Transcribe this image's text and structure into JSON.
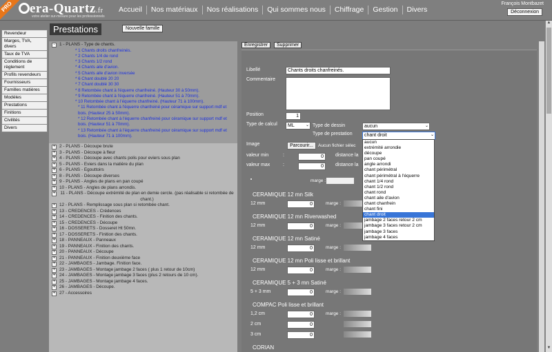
{
  "header": {
    "badge": "PRO",
    "logo_pre": "era-Quartz",
    "logo_suf": ".fr",
    "tagline": "votre atelier sur-mesure pour les professionnels",
    "nav": [
      "Accueil",
      "Nos matériaux",
      "Nos réalisations",
      "Qui sommes nous",
      "Chiffrage",
      "Gestion",
      "Divers"
    ],
    "user": "François Montbazet",
    "logout": "Déconnexion"
  },
  "sidebar": [
    "Revendeur",
    "Marges, TVA, divers",
    "Taux de TVA",
    "Conditions de règlement",
    "Profils revendeurs",
    "Fournisseurs",
    "Familles matières",
    "Modèles",
    "Prestations",
    "Finitions",
    "Civilités",
    "Divers"
  ],
  "page": {
    "title": "Prestations",
    "new_family": "Nouvelle famille"
  },
  "tree": {
    "selected": "1 - PLANS - Type de chants.",
    "selected_toggle": "-",
    "children": [
      "* 1 Chants droits chanfreinés.",
      "* 2 Chants 1/4 de rond",
      "* 3 Chants 1/2 rond",
      "* 4 Chants aile d'avion.",
      "* 5 Chants aile d'avion inversée",
      "* 6 Chant doublé 20 20",
      "* 7 Chant doublé 30 30",
      "* 8 Retombée chant à l'équerre chanfreiné. (Hauteur 30 à 50mm).",
      "* 9 Retombée chant à l'équerre chanfreiné. (Hauteur 51 à 70mm).",
      "* 10 Retombée chant à l'équerre chanfreiné. (Hauteur 71 à 100mm).",
      "* 11 Retombée chant à l'équerre chanfreiné pour céramique sur support mdf et bois. (Hauteur 25 à 50mm).",
      "* 12 Retombée chant à l'équerre chanfreiné pour céramique sur support mdf et bois. (Hauteur 51 à 70mm).",
      "* 13 Retombée chant à l'équerre chanfreiné pour céramique sur support mdf et bois. (Hauteur 71 à 100mm)."
    ],
    "items": [
      "2 - PLANS - Découpe brute",
      "3 - PLANS - Découpe à  fleur",
      "4 - PLANS - Découpe avec chants polis pour eviers sous plan",
      "5 - PLANS - Eviers dans la matière du plan",
      "6 - PLANS - Egouttoirs",
      "8 - PLANS - Découpe diverses",
      "9 - PLANS - Angles de plans en pan coupé",
      "10 - PLANS - Angles de plans arrondis.",
      "11 - PLANS - Découpe extrémité de plan en demie cercle. (pas réalisable si retombée de chant.)",
      "12 - PLANS - Remplissage sous plan si retombée chant.",
      "13 - CREDENCES - Crédences",
      "14 - CREDENCES - Finition des chants.",
      "15 - CREDENCES - Découpe",
      "16 - DOSSERETS - Dosseret Ht 50mn.",
      "17 - DOSSERETS - Finition des chants.",
      "18 - PANNEAUX - Panneaux",
      "19 - PANNEAUX - Finition des chants.",
      "20 - PANNEAUX - Découpe",
      "21 - PANNEAUX - Finition deuxième face",
      "22 - JAMBAGES - Jambage. Finition face.",
      "23 - JAMBAGES - Montage jambage 2 faces ( plus 1 retour de 10cm)",
      "24 - JAMBAGES - Montage jambage 3 faces (plus 2 retours de 10 cm).",
      "25 - JAMBAGES - Montage jambage 4 faces.",
      "26 - JAMBAGES - Découpe.",
      "27 - Accessoires"
    ],
    "toggle": "+"
  },
  "toolbar": {
    "save": "Enregistrer",
    "delete": "Supprimer"
  },
  "form": {
    "libelle_label": "Libellé",
    "libelle": "Chants droits chanfreinés.",
    "comment_label": "Commentaire",
    "position_label": "Position",
    "position": "1",
    "calc_label": "Type de calcul",
    "calc": "ML",
    "dessin_label": "Type de dessin",
    "dessin": "aucun",
    "presta_label": "Type de prestation",
    "presta": "chant droit",
    "image_label": "Image",
    "browse": "Parcourir...",
    "no_file": "Aucun fichier sélec",
    "vmin_label": "valeur min",
    "vmin": "0",
    "vmax_label": "valeur max",
    "vmax": "0",
    "dist1": "distance la",
    "dist2": "distance la",
    "colon": ":",
    "marge": "marge :",
    "materials": [
      {
        "name": "CERAMIQUE 12 mn Silk",
        "rows": [
          {
            "dim": "12 mm",
            "val": "0"
          }
        ]
      },
      {
        "name": "CERAMIQUE 12 mn Riverwashed",
        "rows": [
          {
            "dim": "12 mm",
            "val": "0"
          }
        ]
      },
      {
        "name": "CERAMIQUE 12 mn Satiné",
        "rows": [
          {
            "dim": "12 mm",
            "val": "0"
          }
        ]
      },
      {
        "name": "CERAMIQUE 12 mn Poli lisse et brillant",
        "rows": [
          {
            "dim": "12 mm",
            "val": "0"
          }
        ]
      },
      {
        "name": "CERAMIQUE 5 + 3 mn Satiné",
        "rows": [
          {
            "dim": "5 + 3 mm",
            "val": "0"
          }
        ]
      },
      {
        "name": "COMPAC Poli lisse et brillant",
        "rows": [
          {
            "dim": "1,2 cm",
            "val": "0"
          },
          {
            "dim": "2 cm",
            "val": "0"
          },
          {
            "dim": "3 cm",
            "val": "0"
          }
        ]
      },
      {
        "name": "CORIAN",
        "rows": []
      }
    ]
  },
  "dropdown": {
    "options": [
      "aucun",
      "extrémité arrondie",
      "découpe",
      "pan coupé",
      "angle arrondi",
      "chant périmétral",
      "chant périmétral à l'équerre",
      "chant 1/4 rond",
      "chant 1/2 rond",
      "chant rond",
      "chant aile d'avion",
      "chant chanfrein",
      "chant fini",
      "chant droit",
      "jambage 2 faces retour 2 cm",
      "jambage 3 faces retour 2 cm",
      "jambage 3 faces",
      "jambage 4 faces"
    ],
    "selected_index": 13
  }
}
